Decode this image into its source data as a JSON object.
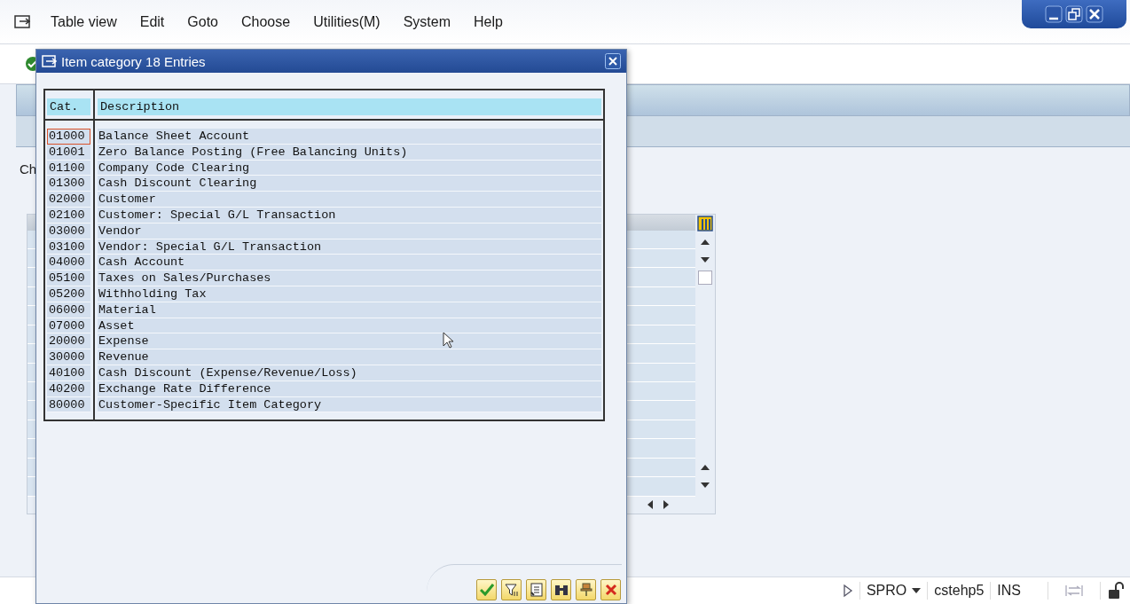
{
  "menu_bar": [
    "Table view",
    "Edit",
    "Goto",
    "Choose",
    "Utilities(M)",
    "System",
    "Help"
  ],
  "background": {
    "label": "Ch"
  },
  "dialog": {
    "title": "Item category 18 Entries",
    "columns": [
      "Cat.",
      "Description"
    ],
    "rows": [
      {
        "cat": "01000",
        "description": "Balance Sheet Account",
        "selected": true
      },
      {
        "cat": "01001",
        "description": "Zero Balance Posting (Free Balancing Units)",
        "selected": false
      },
      {
        "cat": "01100",
        "description": "Company Code Clearing",
        "selected": false
      },
      {
        "cat": "01300",
        "description": "Cash Discount Clearing",
        "selected": false
      },
      {
        "cat": "02000",
        "description": "Customer",
        "selected": false
      },
      {
        "cat": "02100",
        "description": "Customer: Special G/L Transaction",
        "selected": false
      },
      {
        "cat": "03000",
        "description": "Vendor",
        "selected": false
      },
      {
        "cat": "03100",
        "description": "Vendor: Special G/L Transaction",
        "selected": false
      },
      {
        "cat": "04000",
        "description": "Cash Account",
        "selected": false
      },
      {
        "cat": "05100",
        "description": "Taxes on Sales/Purchases",
        "selected": false
      },
      {
        "cat": "05200",
        "description": "Withholding Tax",
        "selected": false
      },
      {
        "cat": "06000",
        "description": "Material",
        "selected": false
      },
      {
        "cat": "07000",
        "description": "Asset",
        "selected": false
      },
      {
        "cat": "20000",
        "description": "Expense",
        "selected": false
      },
      {
        "cat": "30000",
        "description": "Revenue",
        "selected": false
      },
      {
        "cat": "40100",
        "description": "Cash Discount (Expense/Revenue/Loss)",
        "selected": false
      },
      {
        "cat": "40200",
        "description": "Exchange Rate Difference",
        "selected": false
      },
      {
        "cat": "80000",
        "description": "Customer-Specific Item Category",
        "selected": false
      }
    ]
  },
  "status_bar": {
    "transaction": "SPRO",
    "server": "cstehp5",
    "mode": "INS"
  }
}
